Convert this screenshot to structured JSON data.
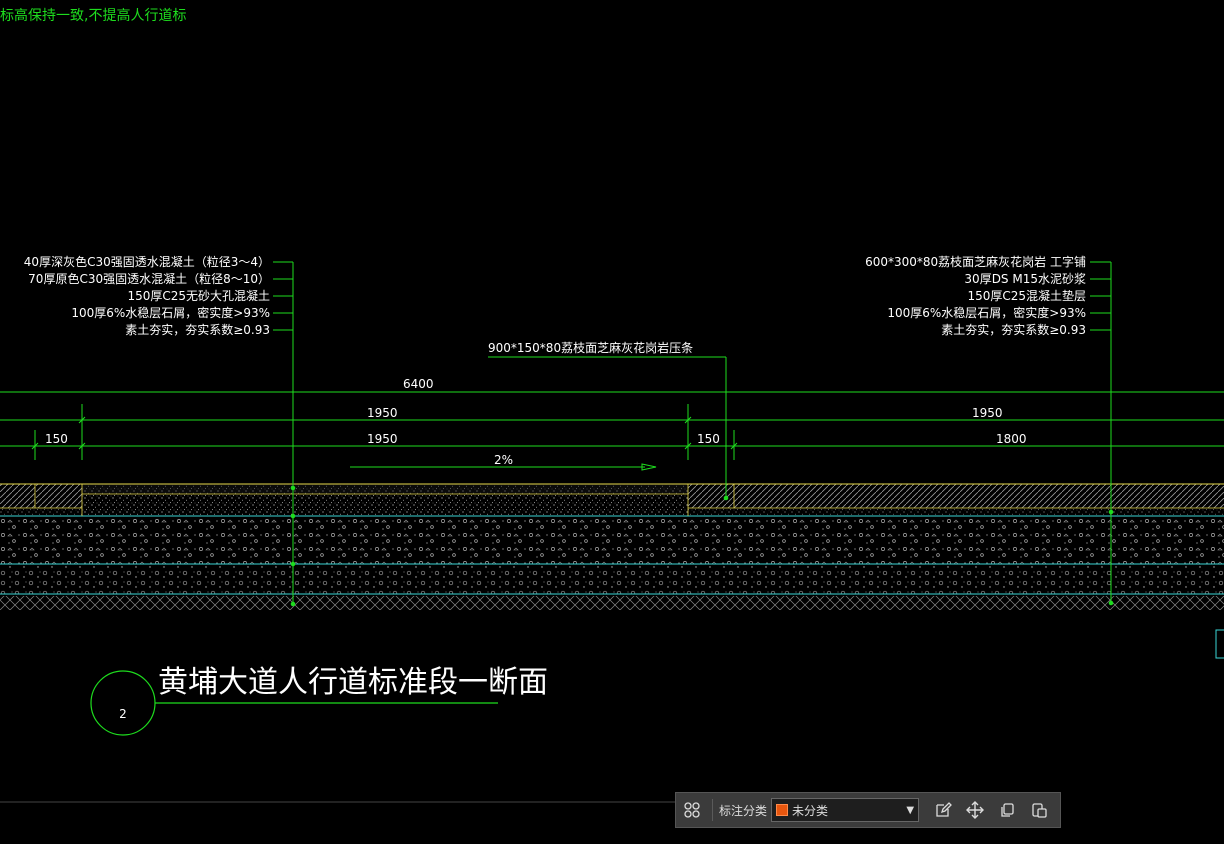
{
  "top_note": "标高保持一致,不提高人行道标",
  "left_callout": [
    "40厚深灰色C30强固透水混凝土（粒径3～4）",
    "70厚原色C30强固透水混凝土（粒径8～10）",
    "150厚C25无砂大孔混凝土",
    "100厚6%水稳层石屑，密实度>93%",
    "素土夯实，夯实系数≥0.93"
  ],
  "right_callout": [
    "600*300*80荔枝面芝麻灰花岗岩 工字铺",
    "30厚DS M15水泥砂浆",
    "150厚C25混凝土垫层",
    "100厚6%水稳层石屑，密实度>93%",
    "素土夯实，夯实系数≥0.93"
  ],
  "curb_callout": "900*150*80荔枝面芝麻灰花岗岩压条",
  "dimensions": {
    "total": "6400",
    "left_upper": "1950",
    "left_lower": "1950",
    "edge_left": "150",
    "edge_mid": "150",
    "right_upper": "1950",
    "right_lower": "1800",
    "slope": "2%"
  },
  "section_title": {
    "number": "2",
    "title": "黄埔大道人行道标准段一断面"
  },
  "toolbar": {
    "label": "标注分类",
    "selected": "未分类",
    "swatch_color": "#e8560e",
    "icons": [
      "grid-icon",
      "edit-icon",
      "move-icon",
      "copy-icon",
      "paste-icon"
    ]
  }
}
